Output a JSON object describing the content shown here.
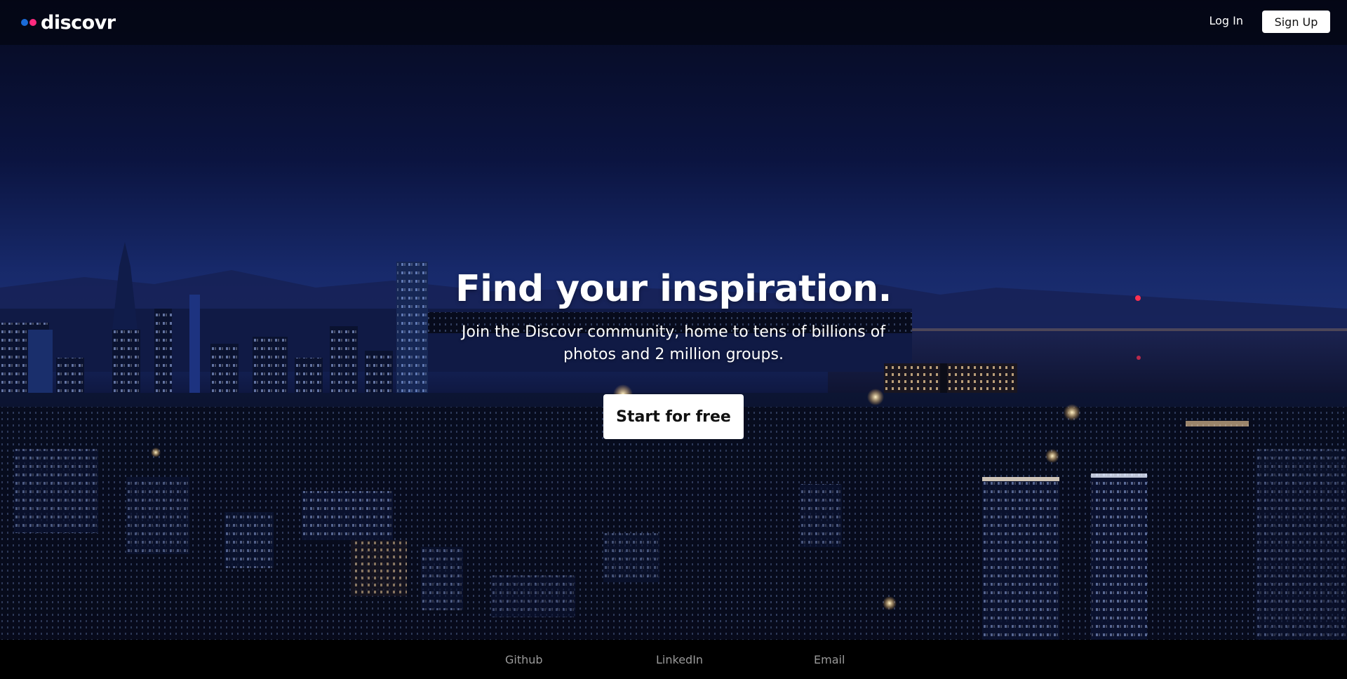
{
  "brand": {
    "name": "discovr",
    "dot_colors": [
      "#1a6bd8",
      "#ff2a7f"
    ]
  },
  "nav": {
    "login_label": "Log In",
    "signup_label": "Sign Up"
  },
  "hero": {
    "headline": "Find your inspiration.",
    "subheadline": "Join the Discovr community, home to tens of billions of photos and 2 million groups.",
    "cta_label": "Start for free"
  },
  "footer": {
    "links": [
      "Github",
      "LinkedIn",
      "Email"
    ]
  }
}
